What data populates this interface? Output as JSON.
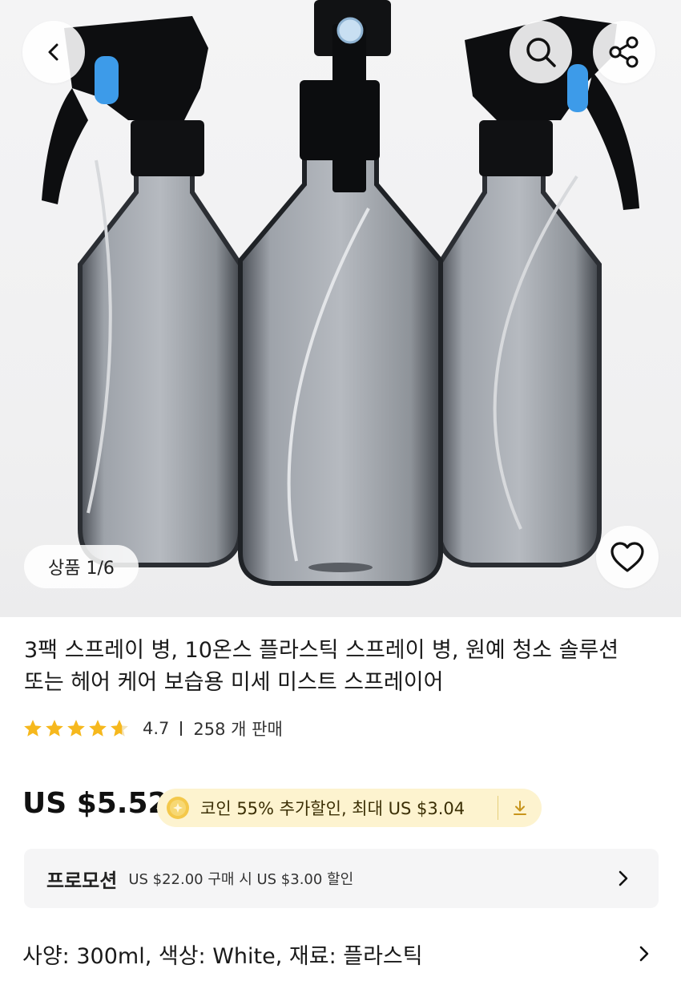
{
  "hero": {
    "counter": "상품 1/6"
  },
  "product": {
    "title_line1": "3팩 스프레이 병, 10온스 플라스틱 스프레이 병, 원예 청소 솔루션",
    "title_line2": "또는 헤어 케어 보습용 미세 미스트 스프레이어",
    "rating_value": "4.7",
    "sold": "258 개 판매",
    "stars": 4.7
  },
  "price": {
    "amount": "US $5.52"
  },
  "coupon": {
    "text": "코인 55% 추가할인, 최대 US $3.04"
  },
  "promotion": {
    "label": "프로모션",
    "text": "US $22.00 구매 시 US $3.00 할인"
  },
  "spec": {
    "text": "사양: 300ml, 색상: White, 재료: 플라스틱"
  },
  "colors": {
    "star": "#f6b81d",
    "coupon_bg": "#fdf3cf",
    "accent_blue": "#3d9be9"
  },
  "icons": [
    "back-icon",
    "search-icon",
    "share-icon",
    "heart-icon",
    "star-icon",
    "coin-icon",
    "download-icon",
    "chevron-right-icon"
  ]
}
